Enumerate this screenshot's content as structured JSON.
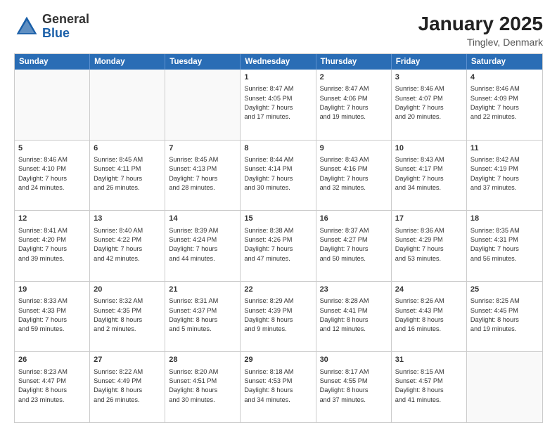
{
  "header": {
    "logo_general": "General",
    "logo_blue": "Blue",
    "month_title": "January 2025",
    "location": "Tinglev, Denmark"
  },
  "weekdays": [
    "Sunday",
    "Monday",
    "Tuesday",
    "Wednesday",
    "Thursday",
    "Friday",
    "Saturday"
  ],
  "rows": [
    [
      {
        "day": "",
        "text": ""
      },
      {
        "day": "",
        "text": ""
      },
      {
        "day": "",
        "text": ""
      },
      {
        "day": "1",
        "text": "Sunrise: 8:47 AM\nSunset: 4:05 PM\nDaylight: 7 hours\nand 17 minutes."
      },
      {
        "day": "2",
        "text": "Sunrise: 8:47 AM\nSunset: 4:06 PM\nDaylight: 7 hours\nand 19 minutes."
      },
      {
        "day": "3",
        "text": "Sunrise: 8:46 AM\nSunset: 4:07 PM\nDaylight: 7 hours\nand 20 minutes."
      },
      {
        "day": "4",
        "text": "Sunrise: 8:46 AM\nSunset: 4:09 PM\nDaylight: 7 hours\nand 22 minutes."
      }
    ],
    [
      {
        "day": "5",
        "text": "Sunrise: 8:46 AM\nSunset: 4:10 PM\nDaylight: 7 hours\nand 24 minutes."
      },
      {
        "day": "6",
        "text": "Sunrise: 8:45 AM\nSunset: 4:11 PM\nDaylight: 7 hours\nand 26 minutes."
      },
      {
        "day": "7",
        "text": "Sunrise: 8:45 AM\nSunset: 4:13 PM\nDaylight: 7 hours\nand 28 minutes."
      },
      {
        "day": "8",
        "text": "Sunrise: 8:44 AM\nSunset: 4:14 PM\nDaylight: 7 hours\nand 30 minutes."
      },
      {
        "day": "9",
        "text": "Sunrise: 8:43 AM\nSunset: 4:16 PM\nDaylight: 7 hours\nand 32 minutes."
      },
      {
        "day": "10",
        "text": "Sunrise: 8:43 AM\nSunset: 4:17 PM\nDaylight: 7 hours\nand 34 minutes."
      },
      {
        "day": "11",
        "text": "Sunrise: 8:42 AM\nSunset: 4:19 PM\nDaylight: 7 hours\nand 37 minutes."
      }
    ],
    [
      {
        "day": "12",
        "text": "Sunrise: 8:41 AM\nSunset: 4:20 PM\nDaylight: 7 hours\nand 39 minutes."
      },
      {
        "day": "13",
        "text": "Sunrise: 8:40 AM\nSunset: 4:22 PM\nDaylight: 7 hours\nand 42 minutes."
      },
      {
        "day": "14",
        "text": "Sunrise: 8:39 AM\nSunset: 4:24 PM\nDaylight: 7 hours\nand 44 minutes."
      },
      {
        "day": "15",
        "text": "Sunrise: 8:38 AM\nSunset: 4:26 PM\nDaylight: 7 hours\nand 47 minutes."
      },
      {
        "day": "16",
        "text": "Sunrise: 8:37 AM\nSunset: 4:27 PM\nDaylight: 7 hours\nand 50 minutes."
      },
      {
        "day": "17",
        "text": "Sunrise: 8:36 AM\nSunset: 4:29 PM\nDaylight: 7 hours\nand 53 minutes."
      },
      {
        "day": "18",
        "text": "Sunrise: 8:35 AM\nSunset: 4:31 PM\nDaylight: 7 hours\nand 56 minutes."
      }
    ],
    [
      {
        "day": "19",
        "text": "Sunrise: 8:33 AM\nSunset: 4:33 PM\nDaylight: 7 hours\nand 59 minutes."
      },
      {
        "day": "20",
        "text": "Sunrise: 8:32 AM\nSunset: 4:35 PM\nDaylight: 8 hours\nand 2 minutes."
      },
      {
        "day": "21",
        "text": "Sunrise: 8:31 AM\nSunset: 4:37 PM\nDaylight: 8 hours\nand 5 minutes."
      },
      {
        "day": "22",
        "text": "Sunrise: 8:29 AM\nSunset: 4:39 PM\nDaylight: 8 hours\nand 9 minutes."
      },
      {
        "day": "23",
        "text": "Sunrise: 8:28 AM\nSunset: 4:41 PM\nDaylight: 8 hours\nand 12 minutes."
      },
      {
        "day": "24",
        "text": "Sunrise: 8:26 AM\nSunset: 4:43 PM\nDaylight: 8 hours\nand 16 minutes."
      },
      {
        "day": "25",
        "text": "Sunrise: 8:25 AM\nSunset: 4:45 PM\nDaylight: 8 hours\nand 19 minutes."
      }
    ],
    [
      {
        "day": "26",
        "text": "Sunrise: 8:23 AM\nSunset: 4:47 PM\nDaylight: 8 hours\nand 23 minutes."
      },
      {
        "day": "27",
        "text": "Sunrise: 8:22 AM\nSunset: 4:49 PM\nDaylight: 8 hours\nand 26 minutes."
      },
      {
        "day": "28",
        "text": "Sunrise: 8:20 AM\nSunset: 4:51 PM\nDaylight: 8 hours\nand 30 minutes."
      },
      {
        "day": "29",
        "text": "Sunrise: 8:18 AM\nSunset: 4:53 PM\nDaylight: 8 hours\nand 34 minutes."
      },
      {
        "day": "30",
        "text": "Sunrise: 8:17 AM\nSunset: 4:55 PM\nDaylight: 8 hours\nand 37 minutes."
      },
      {
        "day": "31",
        "text": "Sunrise: 8:15 AM\nSunset: 4:57 PM\nDaylight: 8 hours\nand 41 minutes."
      },
      {
        "day": "",
        "text": ""
      }
    ]
  ]
}
